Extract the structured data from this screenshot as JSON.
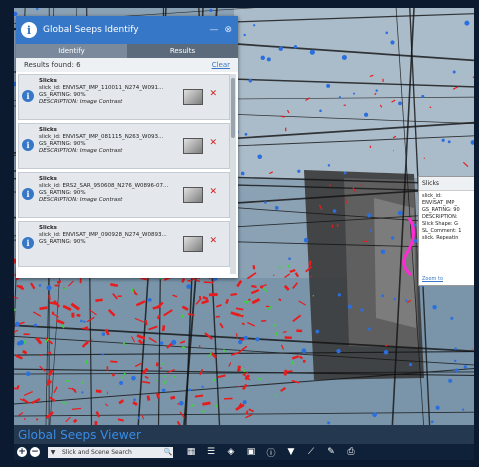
{
  "panel": {
    "title": "Global Seeps Identify",
    "minimize_glyph": "—",
    "close_glyph": "⊗",
    "tabs": [
      {
        "label": "Identify",
        "active": false
      },
      {
        "label": "Results",
        "active": true
      }
    ],
    "results_found": "Results found: 6",
    "clear_label": "Clear",
    "results": [
      {
        "layer": "Slicks",
        "name": "slick_id: ENVISAT_IMP_110011_N274_W091...",
        "rating": "GS_RATING: 90%",
        "description": "DESCRIPTION: Image Contrast"
      },
      {
        "layer": "Slicks",
        "name": "slick_id: ENVISAT_IMP_081115_N263_W093...",
        "rating": "GS_RATING: 90%",
        "description": "DESCRIPTION: Image Contrast"
      },
      {
        "layer": "Slicks",
        "name": "slick_id: ERS2_SAR_950608_N276_W0896-07...",
        "rating": "GS_RATING: 90%",
        "description": "DESCRIPTION: Image Contrast"
      },
      {
        "layer": "Slicks",
        "name": "slick_id: ENVISAT_IMP_090928_N274_W0893...",
        "rating": "GS_RATING: 90%",
        "description": ""
      }
    ]
  },
  "popup": {
    "title": "Slicks",
    "lines": [
      "slick_id:",
      "ENVISAT_IMP_",
      "GS_RATING: 90",
      "DESCRIPTION:",
      "Slick Shape: G",
      "SL_Comment: 1",
      "slick. Repeatin"
    ],
    "zoom_label": "Zoom to"
  },
  "viewer_title": "Global Seeps Viewer",
  "toolbar": {
    "zoom_in": "+",
    "zoom_out": "−",
    "search_arrow": "▼",
    "search_placeholder": "Slick and Scene Search",
    "search_icon_glyph": "🔍",
    "tools": [
      {
        "name": "basemap-grid-icon",
        "glyph": "▦"
      },
      {
        "name": "list-icon",
        "glyph": "☰"
      },
      {
        "name": "layers-icon",
        "glyph": "◈"
      },
      {
        "name": "save-icon",
        "glyph": "▣"
      },
      {
        "name": "info-icon",
        "glyph": "ⓘ"
      },
      {
        "name": "filter-icon",
        "glyph": "▼"
      },
      {
        "name": "measure-icon",
        "glyph": "⟋"
      },
      {
        "name": "draw-icon",
        "glyph": "✎"
      },
      {
        "name": "print-icon",
        "glyph": "⎙"
      }
    ]
  },
  "colors": {
    "panel_header": "#3677c8",
    "bar": "#0f2139",
    "viewer_title": "#3a8ce6"
  }
}
